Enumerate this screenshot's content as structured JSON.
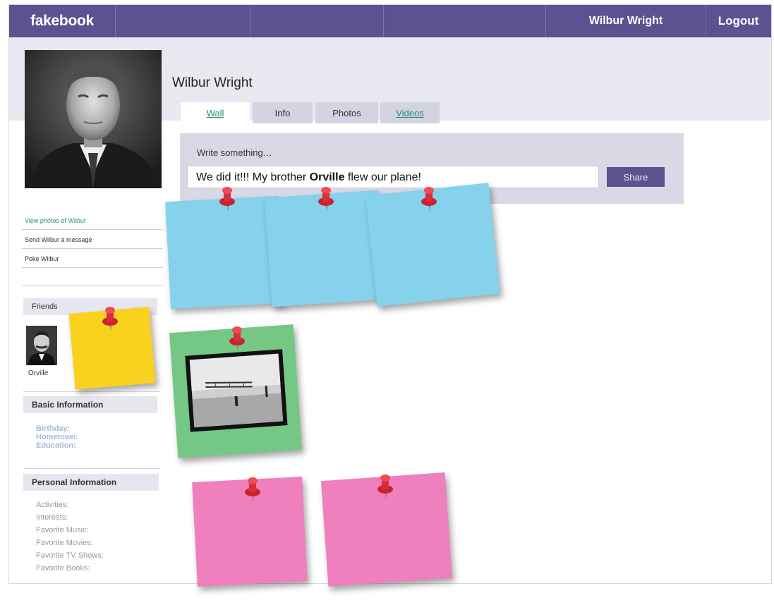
{
  "topbar": {
    "logo": "fakebook",
    "user_name": "Wilbur Wright",
    "logout": "Logout"
  },
  "profile": {
    "name": "Wilbur Wright"
  },
  "tabs": [
    {
      "label": "Wall",
      "active": true
    },
    {
      "label": "Info",
      "active": false
    },
    {
      "label": "Photos",
      "active": false
    },
    {
      "label": "Videos",
      "active": false
    }
  ],
  "composer": {
    "label": "Write something…",
    "text_before": "We did it!!! My brother ",
    "text_bold": "Orville",
    "text_after": " flew our plane!",
    "share": "Share"
  },
  "sidebar": {
    "links": [
      "View photos of Wilbur",
      "Send Wilbur a message",
      "Poke Wilbur"
    ],
    "friends_header": "Friends",
    "friend_name": "Orville",
    "basic_header": "Basic Information",
    "basic_fields": [
      "Birthday:",
      "Hometown:",
      "Education:"
    ],
    "personal_header": "Personal Information",
    "personal_fields": [
      "Activities:",
      "Interests:",
      "Favorite Music:",
      "Favorite Movies:",
      "Favorite TV Shows:",
      "Favorite Books:"
    ]
  },
  "colors": {
    "nav": "#5b5390",
    "note_blue": "#86d1ec",
    "note_yellow": "#fbd11f",
    "note_green": "#74c784",
    "note_pink": "#ef7fbd",
    "pin": "#e0343f"
  },
  "icons": [
    "pushpin-icon",
    "profile-photo",
    "friend-photo",
    "airplane-photo"
  ]
}
